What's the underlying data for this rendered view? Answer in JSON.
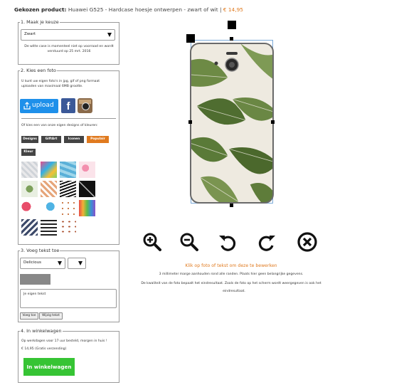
{
  "header": {
    "label": "Gekozen product:",
    "product": "Huawei G525 - Hardcase hoesje ontwerpen - zwart of wit |",
    "price": "€ 14,95"
  },
  "step1": {
    "legend": "1. Maak je keuze",
    "select_value": "Zwart",
    "note": "De witte case is momenteel niet op voorraad en wordt verstuurd op 25 mrt. 2016"
  },
  "step2": {
    "legend": "2. Kies een foto",
    "intro": "U kunt uw eigen foto's in jpg, gif of png formaat uploaden van maximaal 6MB grootte.",
    "upload_label": "upload",
    "designs_intro": "Of kies een van onze eigen designs of kleuren:",
    "tabs": [
      "Designs",
      "GiftArt",
      "Iconen",
      "Populair",
      "Kleur"
    ]
  },
  "step3": {
    "legend": "3. Voeg tekst toe",
    "font_value": "Delicious",
    "text_placeholder": "Je eigen tekst",
    "add_label": "Voeg toe",
    "clear_label": "Wijzig tekst"
  },
  "step4": {
    "legend": "4. In winkelwagen",
    "delivery": "Op werkdagen voor 17 uur besteld, morgen in huis !",
    "price_line": "€ 14,95 (Gratis verzending)",
    "cart_label": "In winkelwagen"
  },
  "editor": {
    "edit_hint": "Klik op foto of tekst om deze te bewerken",
    "margin_note": "3 millimeter marge aanhouden rond alle randen. Plaats hier geen belangrijke gegevens.",
    "quality_note_1": "De kwaliteit van de foto bepaalt het eindresultaat. Zoals de foto op het scherm wordt weergegeven is ook het",
    "quality_note_2": "eindresultaat."
  },
  "colors": {
    "accent_orange": "#e07a1f",
    "upload_blue": "#1e90ea",
    "cart_green": "#36c434",
    "tab_dark": "#444444",
    "leaf_green": "#5f7d3a"
  }
}
